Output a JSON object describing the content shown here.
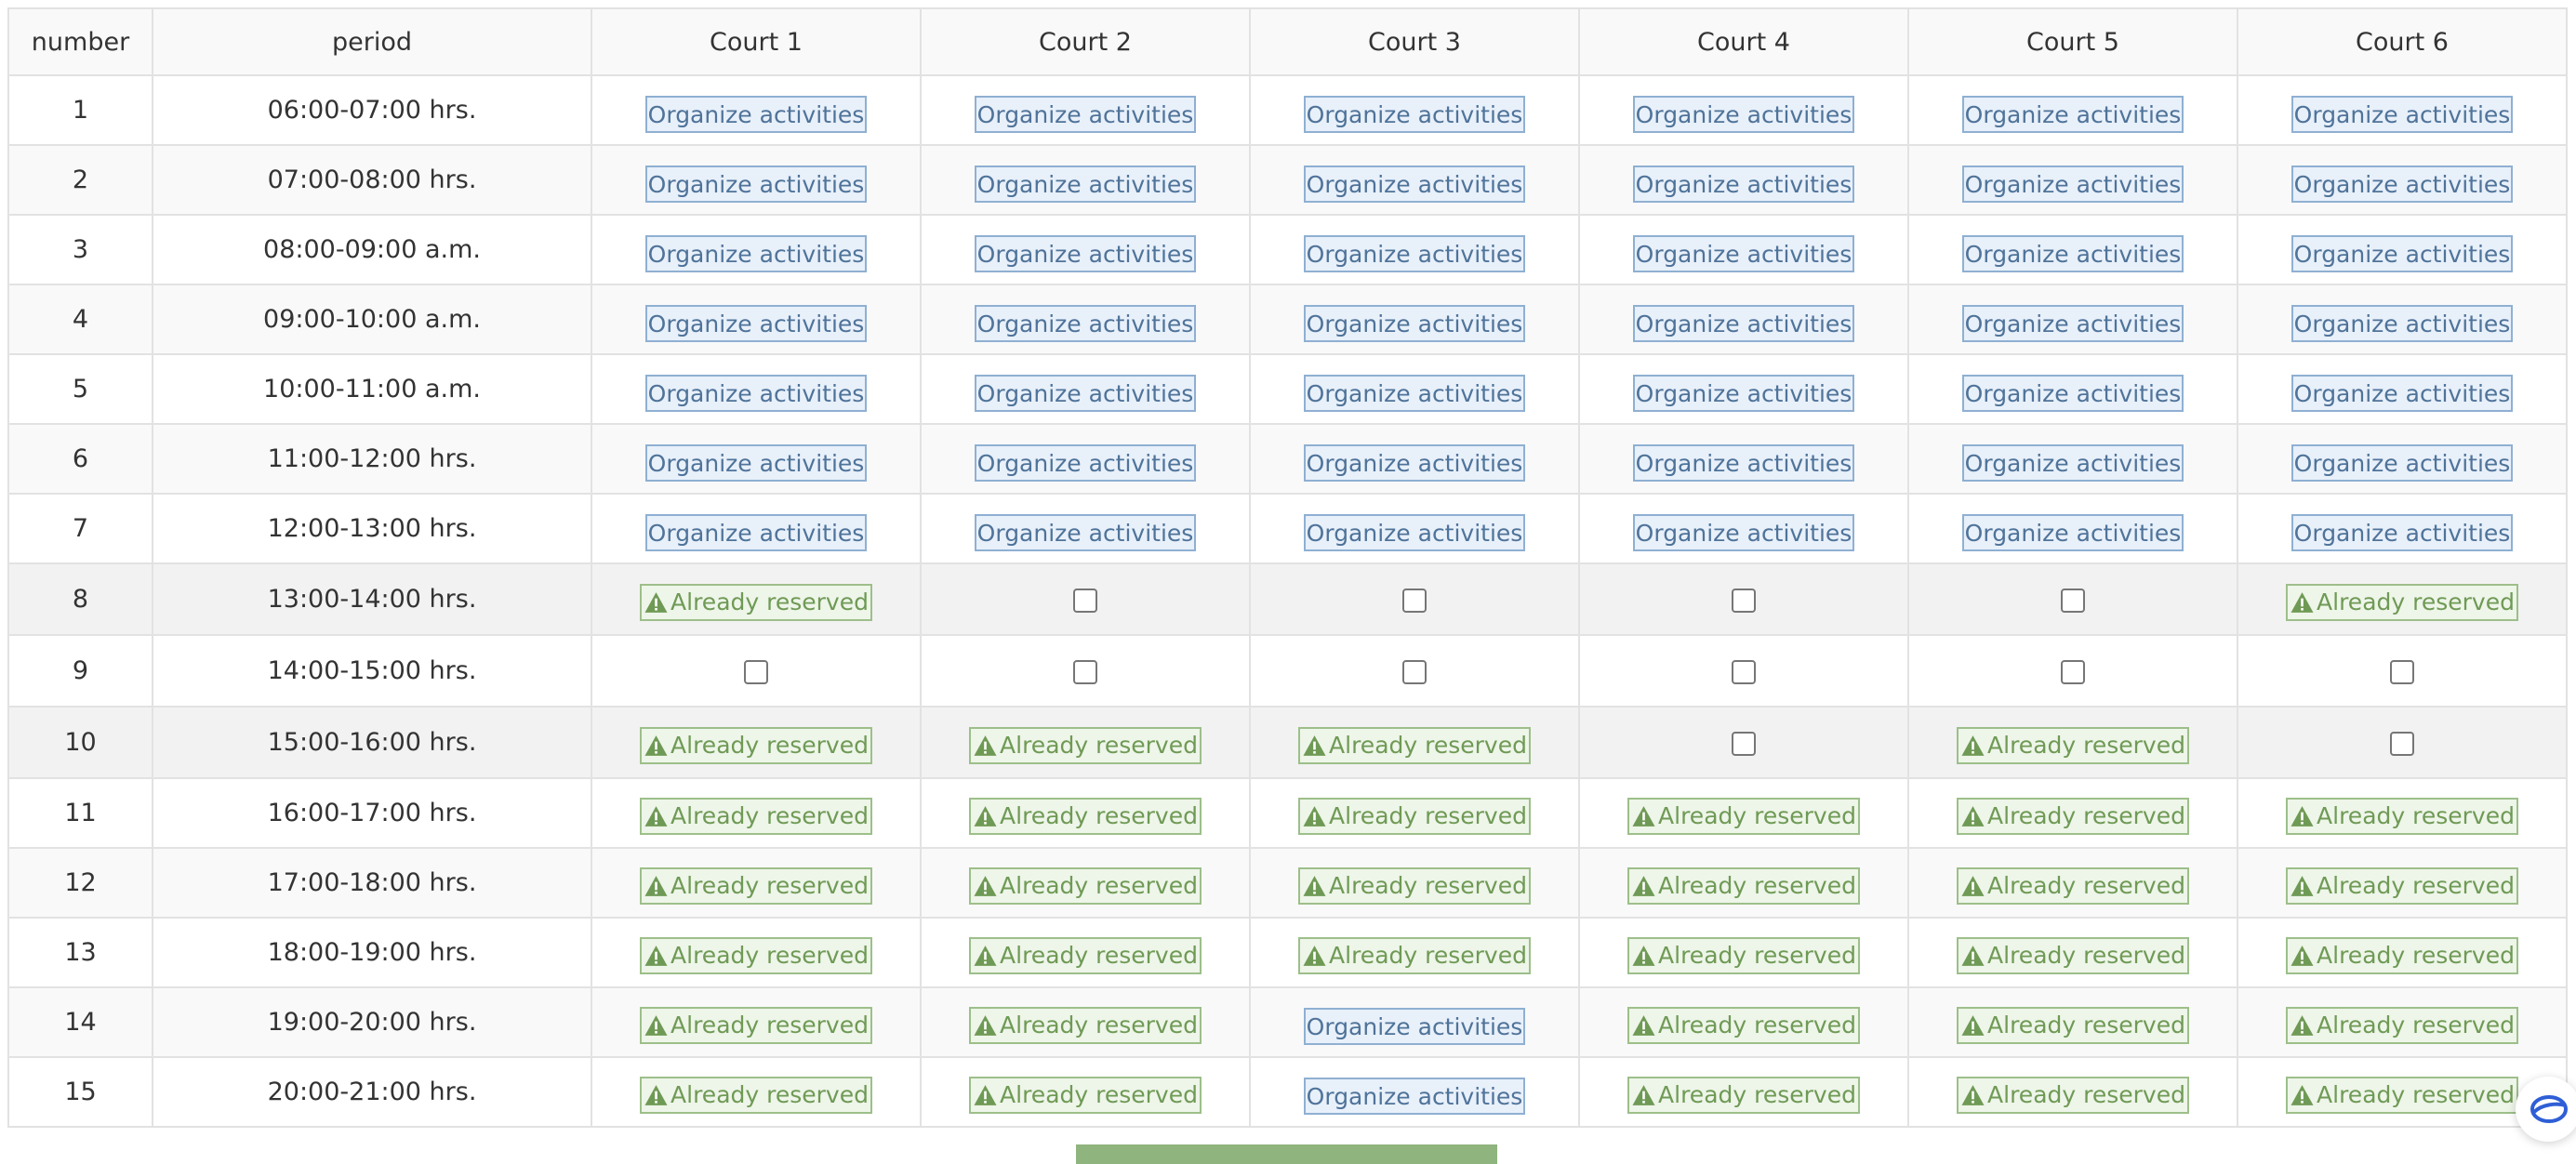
{
  "table": {
    "headers": [
      "number",
      "period",
      "Court 1",
      "Court 2",
      "Court 3",
      "Court 4",
      "Court 5",
      "Court 6"
    ],
    "rows": [
      {
        "number": "1",
        "period": "06:00-07:00 hrs.",
        "cells": [
          "organize",
          "organize",
          "organize",
          "organize",
          "organize",
          "organize"
        ]
      },
      {
        "number": "2",
        "period": "07:00-08:00 hrs.",
        "cells": [
          "organize",
          "organize",
          "organize",
          "organize",
          "organize",
          "organize"
        ]
      },
      {
        "number": "3",
        "period": "08:00-09:00 a.m.",
        "cells": [
          "organize",
          "organize",
          "organize",
          "organize",
          "organize",
          "organize"
        ]
      },
      {
        "number": "4",
        "period": "09:00-10:00 a.m.",
        "cells": [
          "organize",
          "organize",
          "organize",
          "organize",
          "organize",
          "organize"
        ]
      },
      {
        "number": "5",
        "period": "10:00-11:00 a.m.",
        "cells": [
          "organize",
          "organize",
          "organize",
          "organize",
          "organize",
          "organize"
        ]
      },
      {
        "number": "6",
        "period": "11:00-12:00 hrs.",
        "cells": [
          "organize",
          "organize",
          "organize",
          "organize",
          "organize",
          "organize"
        ]
      },
      {
        "number": "7",
        "period": "12:00-13:00 hrs.",
        "cells": [
          "organize",
          "organize",
          "organize",
          "organize",
          "organize",
          "organize"
        ]
      },
      {
        "number": "8",
        "period": "13:00-14:00 hrs.",
        "cells": [
          "reserved",
          "available",
          "available",
          "available",
          "available",
          "reserved"
        ]
      },
      {
        "number": "9",
        "period": "14:00-15:00 hrs.",
        "cells": [
          "available",
          "available",
          "available",
          "available",
          "available",
          "available"
        ]
      },
      {
        "number": "10",
        "period": "15:00-16:00 hrs.",
        "cells": [
          "reserved",
          "reserved",
          "reserved",
          "available",
          "reserved",
          "available"
        ]
      },
      {
        "number": "11",
        "period": "16:00-17:00 hrs.",
        "cells": [
          "reserved",
          "reserved",
          "reserved",
          "reserved",
          "reserved",
          "reserved"
        ]
      },
      {
        "number": "12",
        "period": "17:00-18:00 hrs.",
        "cells": [
          "reserved",
          "reserved",
          "reserved",
          "reserved",
          "reserved",
          "reserved"
        ]
      },
      {
        "number": "13",
        "period": "18:00-19:00 hrs.",
        "cells": [
          "reserved",
          "reserved",
          "reserved",
          "reserved",
          "reserved",
          "reserved"
        ]
      },
      {
        "number": "14",
        "period": "19:00-20:00 hrs.",
        "cells": [
          "reserved",
          "reserved",
          "organize",
          "reserved",
          "reserved",
          "reserved"
        ]
      },
      {
        "number": "15",
        "period": "20:00-21:00 hrs.",
        "cells": [
          "reserved",
          "reserved",
          "organize",
          "reserved",
          "reserved",
          "reserved"
        ]
      }
    ]
  },
  "labels": {
    "organize": "Organize activities",
    "reserved": "Already reserved"
  },
  "icons": {
    "reserved": "warning-triangle-icon",
    "chat": "chat-icon"
  },
  "colors": {
    "organize_bg": "#e8f0fa",
    "organize_border": "#8fb0d2",
    "organize_text": "#4f7399",
    "reserved_bg": "#eef5e9",
    "reserved_border": "#9dbf8a",
    "reserved_text": "#6f9a55",
    "submit_bar": "#8fb47e"
  }
}
